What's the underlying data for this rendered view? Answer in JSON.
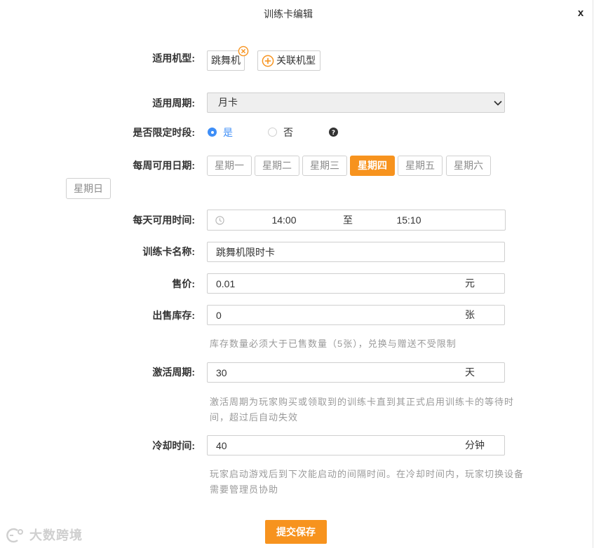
{
  "dialog": {
    "title": "训练卡编辑",
    "close_label": "x"
  },
  "colors": {
    "accent": "#f7931e",
    "blue": "#3e8ef7"
  },
  "form": {
    "device_type": {
      "label": "适用机型:",
      "tag": "跳舞机",
      "tag_remove_icon": "close-circle-icon",
      "add_icon": "plus-circle-icon",
      "add_label": "关联机型"
    },
    "period": {
      "label": "适用周期:",
      "selected": "月卡",
      "icon": "chevron-down-icon"
    },
    "limit_time": {
      "label": "是否限定时段:",
      "options": [
        {
          "label": "是",
          "checked": true
        },
        {
          "label": "否",
          "checked": false
        }
      ],
      "help_icon": "question-circle-icon"
    },
    "weekdays": {
      "label": "每周可用日期:",
      "days": [
        {
          "label": "星期一",
          "selected": false
        },
        {
          "label": "星期二",
          "selected": false
        },
        {
          "label": "星期三",
          "selected": false
        },
        {
          "label": "星期四",
          "selected": true
        },
        {
          "label": "星期五",
          "selected": false
        },
        {
          "label": "星期六",
          "selected": false
        },
        {
          "label": "星期日",
          "selected": false
        }
      ]
    },
    "daily_time": {
      "label": "每天可用时间:",
      "icon": "clock-icon",
      "start": "14:00",
      "separator": "至",
      "end": "15:10"
    },
    "name": {
      "label": "训练卡名称:",
      "value": "跳舞机限时卡"
    },
    "price": {
      "label": "售价:",
      "value": "0.01",
      "unit": "元"
    },
    "stock": {
      "label": "出售库存:",
      "value": "0",
      "unit": "张",
      "hint": [
        "库存数量必须大于已售数量（5张），兑换与赠送不受限制"
      ]
    },
    "activation": {
      "label": "激活周期:",
      "value": "30",
      "unit": "天",
      "hint": [
        "激活周期为玩家购买或领取到的训练卡直到其正式启用训练卡的等待时",
        "间，超过后自动失效"
      ]
    },
    "cooldown": {
      "label": "冷却时间:",
      "value": "40",
      "unit": "分钟",
      "hint": [
        "玩家启动游戏后到下次能启动的间隔时间。在冷却时间内，玩家切换设备",
        "需要管理员协助"
      ]
    },
    "submit_label": "提交保存"
  },
  "watermark": "大数跨境"
}
